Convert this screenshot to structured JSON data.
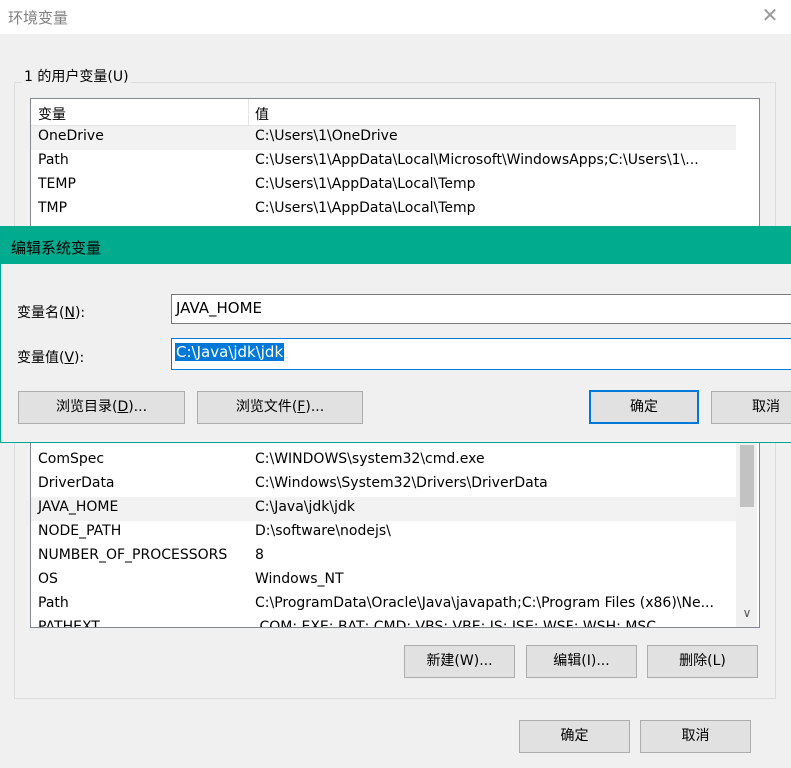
{
  "window": {
    "title": "环境变量"
  },
  "user_vars": {
    "group_title": "1 的用户变量(U)",
    "headers": {
      "name": "变量",
      "value": "值"
    },
    "rows": [
      {
        "name": "OneDrive",
        "value": "C:\\Users\\1\\OneDrive"
      },
      {
        "name": "Path",
        "value": "C:\\Users\\1\\AppData\\Local\\Microsoft\\WindowsApps;C:\\Users\\1\\..."
      },
      {
        "name": "TEMP",
        "value": "C:\\Users\\1\\AppData\\Local\\Temp"
      },
      {
        "name": "TMP",
        "value": "C:\\Users\\1\\AppData\\Local\\Temp"
      }
    ]
  },
  "edit_dialog": {
    "title": "编辑系统变量",
    "name_label_pre": "变量名(",
    "name_label_key": "N",
    "name_label_post": "):",
    "name_value": "JAVA_HOME",
    "value_label_pre": "变量值(",
    "value_label_key": "V",
    "value_label_post": "):",
    "value_value": "C:\\Java\\jdk\\jdk",
    "browse_dir_pre": "浏览目录(",
    "browse_dir_key": "D",
    "browse_dir_post": ")...",
    "browse_file_pre": "浏览文件(",
    "browse_file_key": "F",
    "browse_file_post": ")...",
    "ok": "确定",
    "cancel": "取消"
  },
  "system_vars": {
    "rows": [
      {
        "name": "ComSpec",
        "value": "C:\\WINDOWS\\system32\\cmd.exe"
      },
      {
        "name": "DriverData",
        "value": "C:\\Windows\\System32\\Drivers\\DriverData"
      },
      {
        "name": "JAVA_HOME",
        "value": "C:\\Java\\jdk\\jdk"
      },
      {
        "name": "NODE_PATH",
        "value": "D:\\software\\nodejs\\"
      },
      {
        "name": "NUMBER_OF_PROCESSORS",
        "value": "8"
      },
      {
        "name": "OS",
        "value": "Windows_NT"
      },
      {
        "name": "Path",
        "value": "C:\\ProgramData\\Oracle\\Java\\javapath;C:\\Program Files (x86)\\Ne..."
      },
      {
        "name": "PATHEXT",
        "value": ".COM;.EXE;.BAT;.CMD;.VBS;.VBE;.JS;.JSE;.WSF;.WSH;.MSC"
      }
    ],
    "selected_index": 2,
    "new_button": "新建(W)...",
    "edit_button": "编辑(I)...",
    "delete_button": "删除(L)"
  },
  "footer": {
    "ok": "确定",
    "cancel": "取消"
  },
  "colors": {
    "accent": "#0078d7",
    "dialog_titlebar": "#00ab8e"
  }
}
